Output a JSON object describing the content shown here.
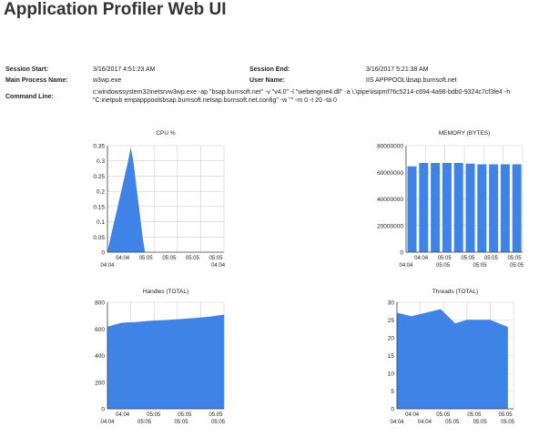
{
  "app": {
    "title": "Application Profiler Web UI"
  },
  "session": {
    "start_label": "Session Start:",
    "start_value": "3/16/2017 4:51:23 AM",
    "end_label": "Session End:",
    "end_value": "3/16/2017 5:21:38 AM",
    "process_label": "Main Process Name:",
    "process_value": "w3wp.exe",
    "user_label": "User Name:",
    "user_value": "IIS APPPOOL\\bsap.burnsoft.net",
    "cmd_label": "Command Line:",
    "cmd_value": "c:windowssystem32inetsrvw3wp.exe -ap \"bsap.burnsoft.net\" -v \"v4.0\" -l \"webengine4.dll\" -a \\.\\pipe\\iisipmf76c5214-c694-4a98-bdb0-9324c7cf3fe4 -h \"C:inetpub empapppoolsbsap.burnsoft.netsap.burnsoft.net.config\" -w \"\" -m 0 -t 20 -ta 0"
  },
  "colors": {
    "series": "#3f83e6",
    "grid": "#d0d0d0",
    "axis": "#444444"
  },
  "chart_data": [
    {
      "id": "cpu",
      "type": "area",
      "title": "CPU %",
      "ylim": [
        0,
        0.35
      ],
      "yticks": [
        "0",
        "0.05",
        "0.1",
        "0.15",
        "0.2",
        "0.25",
        "0.3",
        "0.35"
      ],
      "xtick_labels_top": [
        "04:04",
        "05:05",
        "05:05",
        "05:05",
        "05:05"
      ],
      "xtick_labels_bottom": [
        "04:04",
        "04:04"
      ],
      "series": [
        {
          "values": [
            [
              0.0,
              0.0
            ],
            [
              0.9,
              0.3
            ],
            [
              1.0,
              0.34
            ],
            [
              1.1,
              0.3
            ],
            [
              1.5,
              0.05
            ],
            [
              1.6,
              0.0
            ]
          ],
          "xrange": [
            0,
            5
          ]
        }
      ]
    },
    {
      "id": "memory",
      "type": "bar",
      "title": "MEMORY (BYTES)",
      "ylim": [
        0,
        80000000
      ],
      "yticks": [
        "0",
        "20000000",
        "40000000",
        "60000000",
        "80000000"
      ],
      "xtick_labels_top": [
        "04:04",
        "05:05",
        "05:05",
        "05:05",
        "05:05"
      ],
      "xtick_labels_bottom": [
        "04:04",
        "05:05",
        "05:05",
        "05:05"
      ],
      "series": [
        {
          "values": [
            64500000,
            67000000,
            67000000,
            67000000,
            67000000,
            66500000,
            66000000,
            66000000,
            66000000,
            66000000
          ]
        }
      ]
    },
    {
      "id": "handles",
      "type": "area",
      "title": "Handles (TOTAL)",
      "ylim": [
        0,
        800
      ],
      "yticks": [
        "0",
        "200",
        "400",
        "600",
        "800"
      ],
      "xtick_labels_top": [
        "04:04",
        "05:05",
        "05:05",
        "05:05"
      ],
      "xtick_labels_bottom": [
        "04:04",
        "05:05",
        "05:05",
        "05:05"
      ],
      "series": [
        {
          "values": [
            [
              0,
              615
            ],
            [
              0.5,
              645
            ],
            [
              1.0,
              650
            ],
            [
              1.5,
              660
            ],
            [
              2.0,
              665
            ],
            [
              2.5,
              672
            ],
            [
              3.0,
              680
            ],
            [
              3.5,
              690
            ],
            [
              4.0,
              705
            ]
          ],
          "xrange": [
            0,
            4
          ]
        }
      ]
    },
    {
      "id": "threads",
      "type": "area",
      "title": "Threads (TOTAL)",
      "ylim": [
        0,
        30
      ],
      "yticks": [
        "0",
        "5",
        "10",
        "15",
        "20",
        "25",
        "30"
      ],
      "xtick_labels_top": [
        "04:04",
        "05:05",
        "05:05",
        "05:05"
      ],
      "xtick_labels_bottom": [
        "04:04",
        "04:04",
        "05:05",
        "05:05",
        "05:05"
      ],
      "series": [
        {
          "values": [
            [
              0,
              27
            ],
            [
              0.5,
              26
            ],
            [
              1.5,
              28
            ],
            [
              2.0,
              24
            ],
            [
              2.4,
              25
            ],
            [
              3.2,
              25
            ],
            [
              3.8,
              23
            ]
          ],
          "xrange": [
            0,
            4
          ]
        }
      ]
    }
  ]
}
